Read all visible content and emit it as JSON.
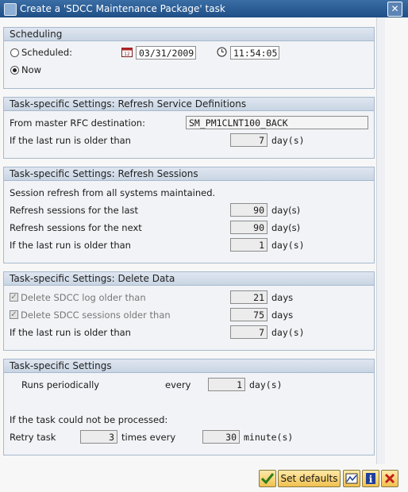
{
  "window": {
    "title": "Create a 'SDCC Maintenance Package' task"
  },
  "scheduling": {
    "header": "Scheduling",
    "scheduled_label": "Scheduled:",
    "now_label": "Now",
    "date": "03/31/2009",
    "time": "11:54:05",
    "selected": "Now"
  },
  "refresh_definitions": {
    "header": "Task-specific Settings: Refresh Service Definitions",
    "rfc_label": "From master RFC destination:",
    "rfc_value": "SM_PM1CLNT100_BACK",
    "older_label": "If the last run is older than",
    "older_value": "7",
    "older_unit": "day(s)"
  },
  "refresh_sessions": {
    "header": "Task-specific Settings: Refresh Sessions",
    "info": "Session refresh from all systems maintained.",
    "last_label": "Refresh sessions for the last",
    "last_value": "90",
    "last_unit": "day(s)",
    "next_label": "Refresh sessions for the next",
    "next_value": "90",
    "next_unit": "day(s)",
    "older_label": "If the last run is older than",
    "older_value": "1",
    "older_unit": "day(s)"
  },
  "delete_data": {
    "header": "Task-specific Settings: Delete Data",
    "log_label": "Delete SDCC log older than",
    "log_value": "21",
    "log_unit": "days",
    "sessions_label": "Delete SDCC sessions older than",
    "sessions_value": "75",
    "sessions_unit": "days",
    "older_label": "If the last run is older than",
    "older_value": "7",
    "older_unit": "day(s)"
  },
  "task_settings": {
    "header": "Task-specific Settings",
    "runs_label": "Runs periodically",
    "every_label": "every",
    "every_value": "1",
    "every_unit": "day(s)",
    "not_processed_label": "If the task could not be processed:",
    "retry_label": "Retry task",
    "retry_value": "3",
    "times_label": "times every",
    "minutes_value": "30",
    "minutes_unit": "minute(s)"
  },
  "footer": {
    "set_defaults_label": "Set defaults"
  },
  "colors": {
    "title_bar": "#1f4f86",
    "group_header": "#c9d5e4",
    "button": "#f0c150",
    "confirm_icon": "#2e7d1a",
    "info_icon": "#1f3f9a",
    "cancel_icon": "#c0201a"
  }
}
